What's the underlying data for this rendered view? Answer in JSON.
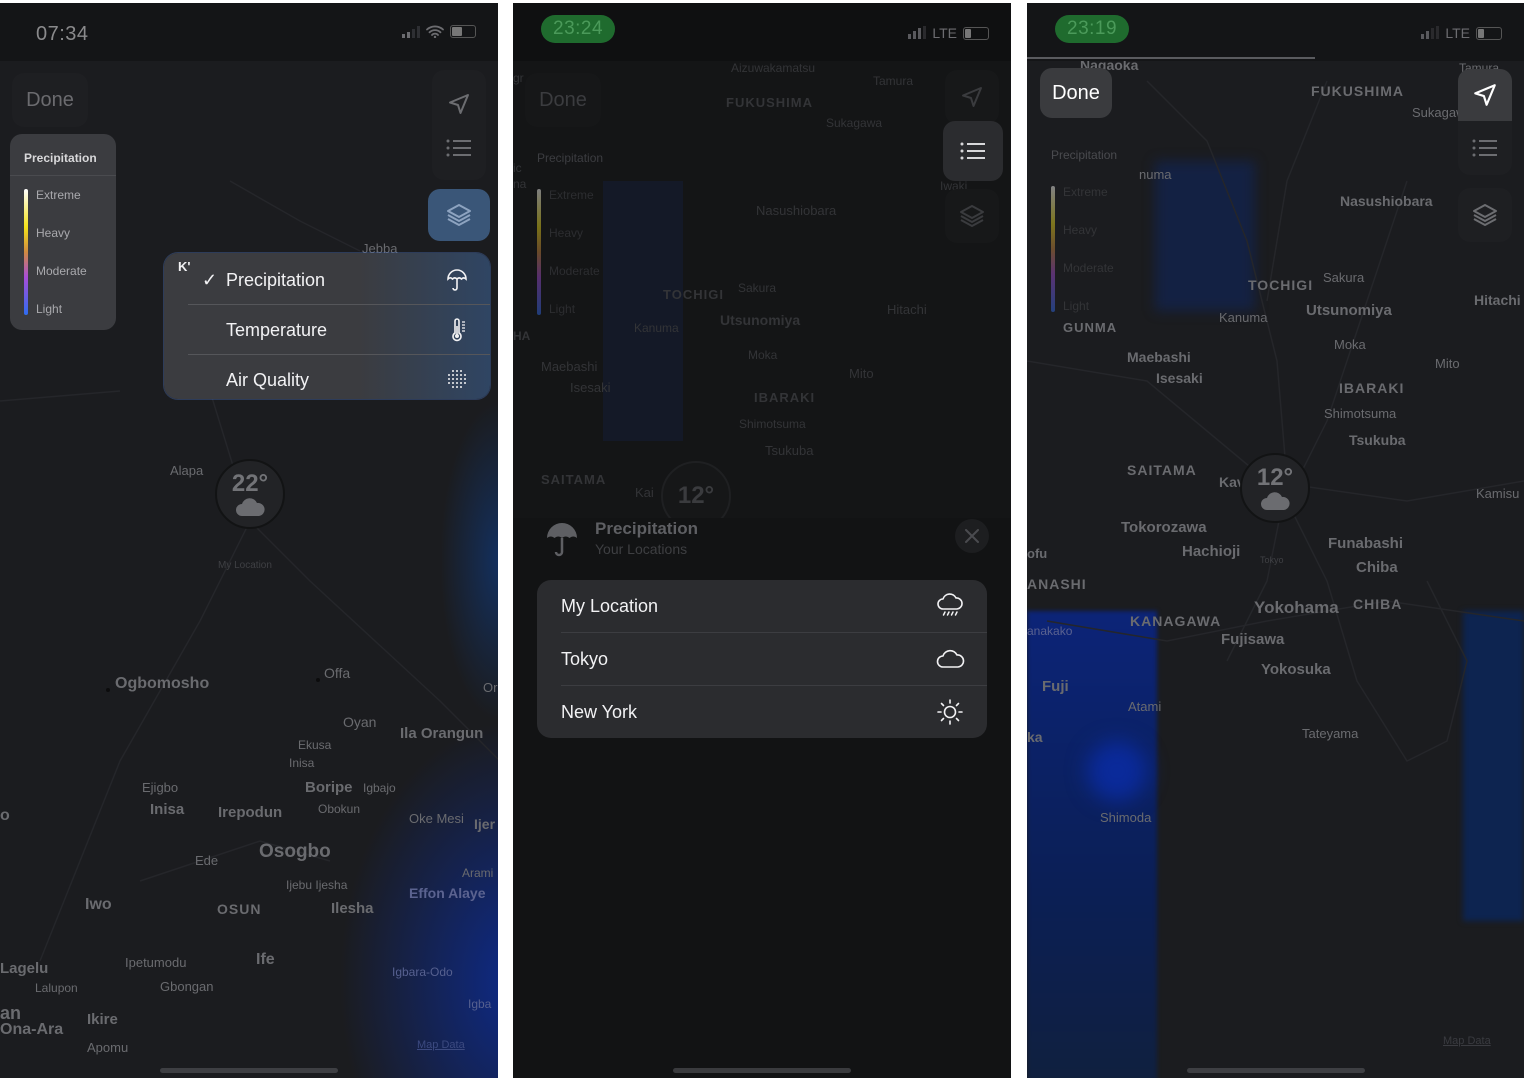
{
  "screen1": {
    "status": {
      "time": "07:34",
      "network": "wifi"
    },
    "done_label": "Done",
    "legend": {
      "title": "Precipitation",
      "levels": [
        "Extreme",
        "Heavy",
        "Moderate",
        "Light"
      ]
    },
    "layer_menu": {
      "items": [
        {
          "label": "Precipitation",
          "checked": true,
          "icon": "umbrella-icon"
        },
        {
          "label": "Temperature",
          "checked": false,
          "icon": "thermometer-icon"
        },
        {
          "label": "Air Quality",
          "checked": false,
          "icon": "air-quality-dots-icon"
        }
      ],
      "check_glyph": "✓",
      "corner_text": "K'"
    },
    "pin": {
      "temp": "22°",
      "label": "My Location",
      "condition": "cloudy"
    },
    "map_labels": [
      "Jebba",
      "Alapa",
      "Ogbomosho",
      "Offa",
      "Oyan",
      "Ila Orangun",
      "Ekusa",
      "Inisa",
      "Ejigbo",
      "Inisa",
      "Irepodun",
      "Boripe",
      "Igbajo",
      "Obokun",
      "Oke Mesi",
      "Ijer",
      "Osogbo",
      "Ede",
      "Arami",
      "Ijebu Ijesha",
      "Effon Alaye",
      "Iwo",
      "OSUN",
      "Ilesha",
      "Lagelu",
      "Ipetumodu",
      "Ife",
      "Igbara-Odo",
      "Lalupon",
      "Gbongan",
      "Igba",
      "an",
      "Ona-Ara",
      "Ikire",
      "Apomu",
      "Or",
      "o",
      "Il"
    ],
    "map_data_link": "Map Data"
  },
  "screen2": {
    "status": {
      "time": "23:24",
      "network": "LTE"
    },
    "done_label": "Done",
    "legend": {
      "title": "Precipitation",
      "levels": [
        "Extreme",
        "Heavy",
        "Moderate",
        "Light"
      ]
    },
    "pin": {
      "temp": "12°"
    },
    "map_labels": [
      "Aizuwakamatsu",
      "Tamura",
      "FUKUSHIMA",
      "Sukagawa",
      "Iwaki",
      "Nasushiobara",
      "TOCHIGI",
      "Sakura",
      "Kanuma",
      "Utsunomiya",
      "Hitachi",
      "Moka",
      "Maebashi",
      "Isesaki",
      "Mito",
      "IBARAKI",
      "Shimotsuma",
      "Tsukuba",
      "SAITAMA",
      "Kai",
      "gr",
      "ic",
      "na",
      "HA"
    ],
    "sheet": {
      "title": "Precipitation",
      "subtitle": "Your Locations",
      "locations": [
        {
          "name": "My Location",
          "icon": "cloud-rain-icon"
        },
        {
          "name": "Tokyo",
          "icon": "cloud-icon"
        },
        {
          "name": "New York",
          "icon": "sun-icon"
        }
      ]
    }
  },
  "screen3": {
    "status": {
      "time": "23:19",
      "network": "LTE"
    },
    "done_label": "Done",
    "legend": {
      "title": "Precipitation",
      "levels": [
        "Extreme",
        "Heavy",
        "Moderate",
        "Light"
      ]
    },
    "pin": {
      "temp": "12°",
      "label": "Tokyo",
      "condition": "cloudy"
    },
    "map_labels": [
      "Nagaoka",
      "Tamura",
      "FUKUSHIMA",
      "Sukagaw",
      "numa",
      "Nasushiobara",
      "TOCHIGI",
      "Sakura",
      "Kanuma",
      "Utsunomiya",
      "Hitachi",
      "GUNMA",
      "Moka",
      "Maebashi",
      "Mito",
      "Isesaki",
      "IBARAKI",
      "Shimotsuma",
      "Tsukuba",
      "SAITAMA",
      "Kav",
      "Kamisu",
      "Tokorozawa",
      "Funabashi",
      "Hachioji",
      "Chiba",
      "ofu",
      "ANASHI",
      "CHIBA",
      "Yokohama",
      "KANAGAWA",
      "anakako",
      "Fujisawa",
      "Yokosuka",
      "Fuji",
      "Atami",
      "Tateyama",
      "ka",
      "Shimoda"
    ],
    "map_data_link": "Map Data"
  },
  "colors": {
    "status_pill_green": "#1f6b2e",
    "precip_blue": "#0b2a8c",
    "menu_bg": "#3b3c40",
    "sheet_bg": "#2b2c2f"
  }
}
